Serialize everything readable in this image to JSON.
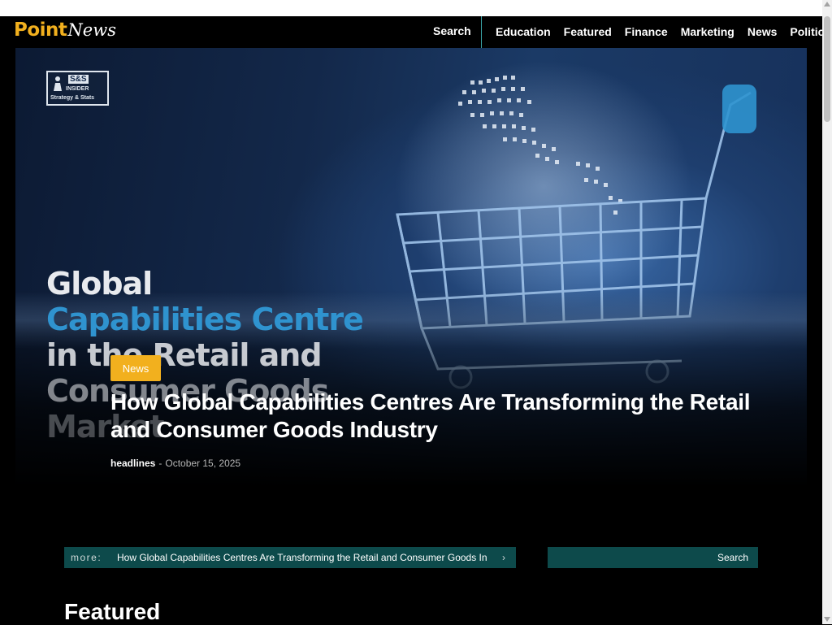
{
  "logo": {
    "part1": "Point",
    "part2": "News"
  },
  "nav": {
    "search_label": "Search",
    "links": [
      "Education",
      "Featured",
      "Finance",
      "Marketing",
      "News",
      "Politics"
    ]
  },
  "hero": {
    "image_logo": {
      "title": "S&S",
      "subtitle": "INSIDER",
      "tagline": "Strategy & Stats"
    },
    "image_text": [
      "Global",
      "Capabilities Centre",
      "in the Retail and",
      "Consumer Goods",
      "Market"
    ],
    "category": "News",
    "title": "How Global Capabilities Centres Are Transforming the Retail and Consumer Goods Industry",
    "author": "headlines",
    "separator": "-",
    "date": "October 15, 2025"
  },
  "ticker": {
    "label": "more:",
    "text": "How Global Capabilities Centres Are Transforming the Retail and Consumer Goods Industry",
    "arrow": "›"
  },
  "search": {
    "value": "",
    "placeholder": "",
    "button_label": "Search"
  },
  "section": {
    "featured_title": "Featured"
  },
  "colors": {
    "accent": "#f2b01e",
    "teal": "#0d4a4b",
    "divider": "#3aa3a6",
    "image_blue": "#2f93cf"
  },
  "icons": {
    "next": "chevron-right-icon",
    "figure": "person-icon"
  }
}
